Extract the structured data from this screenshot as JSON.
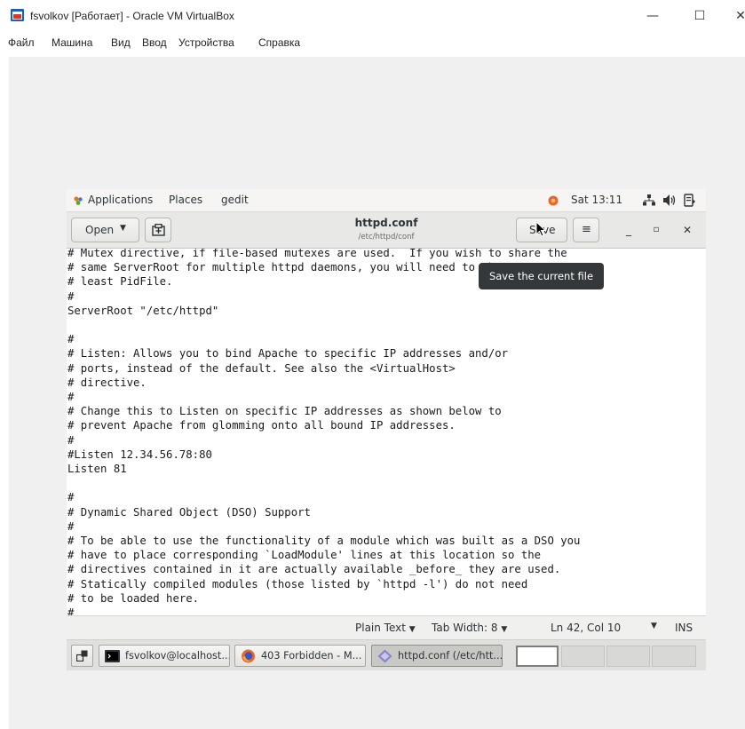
{
  "host": {
    "window_title": "fsvolkov [Работает] - Oracle VM VirtualBox",
    "controls": {
      "minimize": "—",
      "maximize": "☐",
      "close": "✕"
    },
    "menu": [
      "Файл",
      "Машина",
      "Вид",
      "Ввод",
      "Устройства",
      "Справка"
    ]
  },
  "gnome": {
    "topbar": {
      "applications": "Applications",
      "places": "Places",
      "app_name": "gedit",
      "clock": "Sat 13:11"
    }
  },
  "gedit": {
    "open_label": "Open",
    "title": "httpd.conf",
    "subtitle": "/etc/httpd/conf",
    "save_label": "Save",
    "tooltip": "Save the current file",
    "menu_icon": "≡",
    "wm": {
      "minimize": "_",
      "maximize": "▫",
      "close": "✕"
    },
    "lines": [
      "# Mutex directive, if file-based mutexes are used.  If you wish to share the",
      "# same ServerRoot for multiple httpd daemons, you will need to change at",
      "# least PidFile.",
      "#",
      "ServerRoot \"/etc/httpd\"",
      "",
      "#",
      "# Listen: Allows you to bind Apache to specific IP addresses and/or",
      "# ports, instead of the default. See also the <VirtualHost>",
      "# directive.",
      "#",
      "# Change this to Listen on specific IP addresses as shown below to",
      "# prevent Apache from glomming onto all bound IP addresses.",
      "#",
      "#Listen 12.34.56.78:80",
      "Listen 81",
      "",
      "#",
      "# Dynamic Shared Object (DSO) Support",
      "#",
      "# To be able to use the functionality of a module which was built as a DSO you",
      "# have to place corresponding `LoadModule' lines at this location so the",
      "# directives contained in it are actually available _before_ they are used.",
      "# Statically compiled modules (those listed by `httpd -l') do not need",
      "# to be loaded here.",
      "#"
    ],
    "status": {
      "language": "Plain Text",
      "tab_width": "Tab Width: 8",
      "position": "Ln 42, Col 10",
      "mode": "INS"
    }
  },
  "taskbar": {
    "windows": [
      {
        "label": "fsvolkov@localhost...",
        "icon": "terminal-icon"
      },
      {
        "label": "403 Forbidden - M...",
        "icon": "firefox-icon"
      },
      {
        "label": "httpd.conf (/etc/htt...",
        "icon": "gedit-icon",
        "active": true
      }
    ],
    "workspaces": 4,
    "current_workspace": 1
  }
}
